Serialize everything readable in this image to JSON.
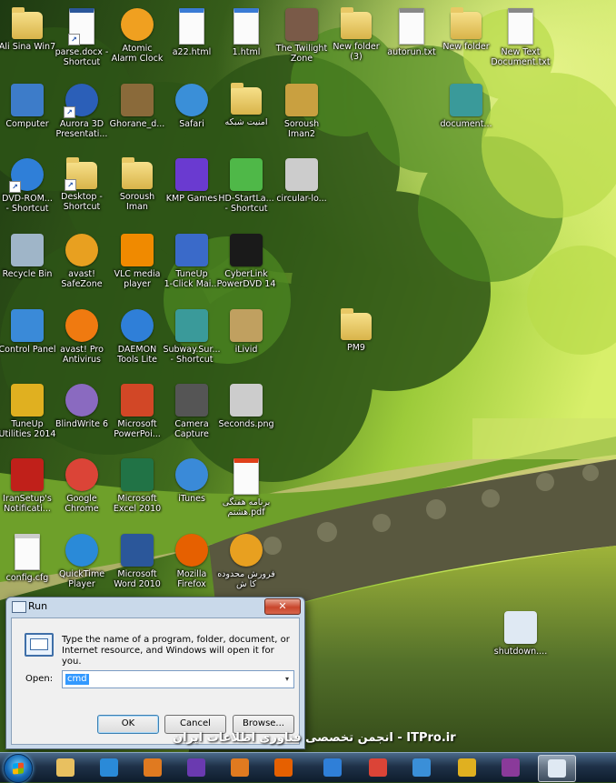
{
  "desktop": {
    "icons": [
      {
        "label": "Ali Sina Win7",
        "icon": "user-folder-icon",
        "color": "#d9b44a",
        "kind": "folder"
      },
      {
        "label": "parse.docx -\nShortcut",
        "icon": "word-doc-icon",
        "color": "#2b579a",
        "kind": "doc"
      },
      {
        "label": "Atomic\nAlarm Clock",
        "icon": "alarm-clock-icon",
        "color": "#f0a020",
        "kind": "round"
      },
      {
        "label": "a22.html",
        "icon": "safari-html-icon",
        "color": "#3a7bd5",
        "kind": "doc"
      },
      {
        "label": "1.html",
        "icon": "safari-html-icon",
        "color": "#3a7bd5",
        "kind": "doc"
      },
      {
        "label": "The Twilight\nZone",
        "icon": "movie-poster-icon",
        "color": "#7a5a48",
        "kind": "plain"
      },
      {
        "label": "New folder\n(3)",
        "icon": "folder-icon",
        "color": "#d9b44a",
        "kind": "folder"
      },
      {
        "label": "autorun.txt",
        "icon": "text-file-icon",
        "color": "#888888",
        "kind": "doc"
      },
      {
        "label": "New folder",
        "icon": "folder-icon",
        "color": "#d9b44a",
        "kind": "folder"
      },
      {
        "label": "New Text\nDocument.txt",
        "icon": "text-file-icon",
        "color": "#888888",
        "kind": "doc"
      },
      {
        "label": "Computer",
        "icon": "computer-icon",
        "color": "#3d7cc9",
        "kind": "plain"
      },
      {
        "label": "Aurora 3D\nPresentati...",
        "icon": "aurora-3d-icon",
        "color": "#2b5fb8",
        "kind": "round"
      },
      {
        "label": "Ghorane_d...",
        "icon": "book-icon",
        "color": "#8a6a3a",
        "kind": "plain"
      },
      {
        "label": "Safari",
        "icon": "safari-icon",
        "color": "#3a8fd8",
        "kind": "round"
      },
      {
        "label": "امنیت شبکه",
        "icon": "folder-icon",
        "color": "#d9b44a",
        "kind": "folder"
      },
      {
        "label": "Soroush\nIman2",
        "icon": "open-book-icon",
        "color": "#c9a040",
        "kind": "plain"
      },
      {
        "label": "document...",
        "icon": "winrar-icon",
        "color": "#3a9a9a",
        "kind": "plain"
      },
      {
        "label": "DVD-ROM...\n- Shortcut",
        "icon": "daemon-tools-icon",
        "color": "#2f7fd8",
        "kind": "round"
      },
      {
        "label": "Desktop -\nShortcut",
        "icon": "folder-icon",
        "color": "#5a8fc9",
        "kind": "folder"
      },
      {
        "label": "Soroush\nIman",
        "icon": "folder-icon",
        "color": "#d9b44a",
        "kind": "folder"
      },
      {
        "label": "KMP Games",
        "icon": "gamepad-icon",
        "color": "#6a3ad0",
        "kind": "plain"
      },
      {
        "label": "HD-StartLa...\n- Shortcut",
        "icon": "bluestacks-icon",
        "color": "#4fb848",
        "kind": "plain"
      },
      {
        "label": "circular-lo...",
        "icon": "image-file-icon",
        "color": "#cccccc",
        "kind": "plain"
      },
      {
        "label": "Recycle Bin",
        "icon": "recycle-bin-icon",
        "color": "#9fb5c8",
        "kind": "plain"
      },
      {
        "label": "avast!\nSafeZone",
        "icon": "avast-safezone-icon",
        "color": "#e8a020",
        "kind": "round"
      },
      {
        "label": "VLC media\nplayer",
        "icon": "vlc-icon",
        "color": "#f08a00",
        "kind": "plain"
      },
      {
        "label": "TuneUp\n1-Click Mai...",
        "icon": "tuneup-icon",
        "color": "#3a6ac9",
        "kind": "plain"
      },
      {
        "label": "CyberLink\nPowerDVD 14",
        "icon": "powerdvd-icon",
        "color": "#1a1a1a",
        "kind": "plain"
      },
      {
        "label": "Control Panel",
        "icon": "control-panel-icon",
        "color": "#3a8ad8",
        "kind": "plain"
      },
      {
        "label": "avast! Pro\nAntivirus",
        "icon": "avast-icon",
        "color": "#f07a10",
        "kind": "round"
      },
      {
        "label": "DAEMON\nTools Lite",
        "icon": "daemon-tools-icon",
        "color": "#2f7fd8",
        "kind": "round"
      },
      {
        "label": "Subway.Sur...\n- Shortcut",
        "icon": "winrar-icon",
        "color": "#3a9a9a",
        "kind": "plain"
      },
      {
        "label": "iLivid",
        "icon": "film-icon",
        "color": "#c0a060",
        "kind": "plain"
      },
      {
        "label": "PM9",
        "icon": "folder-icon",
        "color": "#d9b44a",
        "kind": "folder"
      },
      {
        "label": "TuneUp\nUtilities 2014",
        "icon": "tuneup-utilities-icon",
        "color": "#e0b020",
        "kind": "plain"
      },
      {
        "label": "BlindWrite 6",
        "icon": "disc-icon",
        "color": "#8a6ac0",
        "kind": "round"
      },
      {
        "label": "Microsoft\nPowerPoi...",
        "icon": "powerpoint-icon",
        "color": "#d24726",
        "kind": "plain"
      },
      {
        "label": "Camera\nCapture",
        "icon": "webcam-icon",
        "color": "#555555",
        "kind": "plain"
      },
      {
        "label": "Seconds.png",
        "icon": "image-file-icon",
        "color": "#cccccc",
        "kind": "plain"
      },
      {
        "label": "IranSetup's\nNotificati...",
        "icon": "info-icon",
        "color": "#c0201a",
        "kind": "plain"
      },
      {
        "label": "Google\nChrome",
        "icon": "chrome-icon",
        "color": "#db4437",
        "kind": "round"
      },
      {
        "label": "Microsoft\nExcel 2010",
        "icon": "excel-icon",
        "color": "#217346",
        "kind": "plain"
      },
      {
        "label": "iTunes",
        "icon": "itunes-icon",
        "color": "#3a8ad8",
        "kind": "round"
      },
      {
        "label": "برنامه هفتگی\nهشتم.pdf",
        "icon": "pdf-icon",
        "color": "#e0401a",
        "kind": "doc"
      },
      {
        "label": "config.cfg",
        "icon": "blank-file-icon",
        "color": "#cccccc",
        "kind": "doc"
      },
      {
        "label": "QuickTime\nPlayer",
        "icon": "quicktime-icon",
        "color": "#2a8ad8",
        "kind": "round"
      },
      {
        "label": "Microsoft\nWord 2010",
        "icon": "word-icon",
        "color": "#2b579a",
        "kind": "plain"
      },
      {
        "label": "Mozilla\nFirefox",
        "icon": "firefox-icon",
        "color": "#e66000",
        "kind": "round"
      },
      {
        "label": "فرورش محدوده\nکا ش",
        "icon": "avast-safezone-icon",
        "color": "#e8a020",
        "kind": "round"
      },
      {
        "label": "shutdown....",
        "icon": "shortcut-icon",
        "color": "#dfe9f3",
        "kind": "plain"
      }
    ]
  },
  "run_dialog": {
    "title": "Run",
    "close_label": "✕",
    "description": "Type the name of a program, folder, document, or Internet resource, and Windows will open it for you.",
    "open_label": "Open:",
    "input_value": "cmd",
    "dropdown_glyph": "▾",
    "ok_label": "OK",
    "cancel_label": "Cancel",
    "browse_label": "Browse..."
  },
  "watermark": "انجمن تخصصی فناوری اطلاعات ایران - ITPro.ir",
  "taskbar": {
    "items": [
      {
        "name": "explorer",
        "icon": "folder-icon",
        "color": "#e8c060"
      },
      {
        "name": "internet-explorer",
        "icon": "ie-icon",
        "color": "#2a8ad8"
      },
      {
        "name": "media-player",
        "icon": "play-icon",
        "color": "#e07a20"
      },
      {
        "name": "visual-studio",
        "icon": "visual-studio-icon",
        "color": "#6a3ab0"
      },
      {
        "name": "outlook",
        "icon": "outlook-icon",
        "color": "#e07a20"
      },
      {
        "name": "firefox",
        "icon": "firefox-icon",
        "color": "#e66000"
      },
      {
        "name": "daemon-tools",
        "icon": "daemon-tools-icon",
        "color": "#2f7fd8"
      },
      {
        "name": "chrome",
        "icon": "chrome-icon",
        "color": "#db4437"
      },
      {
        "name": "safari",
        "icon": "safari-icon",
        "color": "#3a8fd8"
      },
      {
        "name": "tuneup",
        "icon": "tuneup-utilities-icon",
        "color": "#e0b020"
      },
      {
        "name": "winrar",
        "icon": "winrar-icon",
        "color": "#8a3a9a"
      },
      {
        "name": "run",
        "icon": "run-icon",
        "color": "#dfe9f3",
        "active": true
      }
    ]
  },
  "colors": {
    "taskbar": "#1f3249",
    "dialog_frame": "#c9d9ea",
    "selection": "#3399ff"
  }
}
